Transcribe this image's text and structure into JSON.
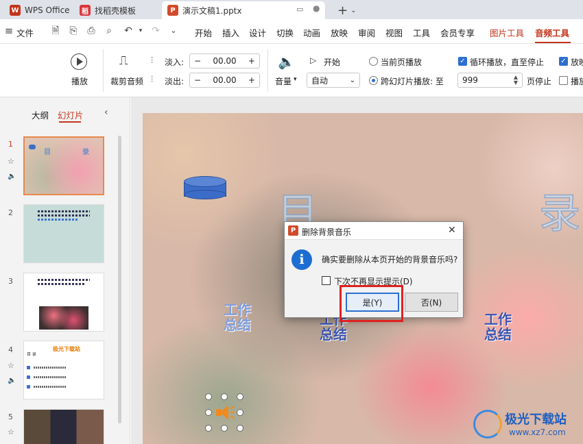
{
  "tabs": {
    "wps": "WPS Office",
    "template": "找稻壳模板",
    "doc": "演示文稿1.pptx",
    "add": "+"
  },
  "menu": {
    "file": "文件",
    "items": [
      "开始",
      "插入",
      "设计",
      "切换",
      "动画",
      "放映",
      "审阅",
      "视图",
      "工具",
      "会员专享"
    ],
    "picture_tools": "图片工具",
    "audio_tools": "音频工具"
  },
  "ribbon": {
    "play": "播放",
    "trim": "裁剪音频",
    "fade_in": "淡入:",
    "fade_in_value": "00.00",
    "fade_out": "淡出:",
    "fade_out_value": "00.00",
    "minus": "−",
    "plus": "+",
    "volume": "音量",
    "start": "开始",
    "start_value": "自动",
    "current_page": "当前页播放",
    "cross_slide": "跨幻灯片播放: 至",
    "page_value": "999",
    "page_stop": "页停止",
    "loop": "循环播放，直至停止",
    "play_hide": "放映",
    "play_rewind": "播放"
  },
  "leftpanel": {
    "outline": "大纲",
    "slides": "幻灯片",
    "slide_numbers": [
      "1",
      "2",
      "3",
      "4",
      "5"
    ],
    "thumb1_title_a": "目",
    "thumb1_title_b": "录",
    "thumb4_title": "极光下载站",
    "thumb4_sub": "目 录"
  },
  "slide": {
    "big_a": "目",
    "big_b": "录",
    "work1": [
      "工作",
      "总结"
    ],
    "work2": [
      "工作",
      "总结"
    ],
    "work3": [
      "工作",
      "总结"
    ]
  },
  "dialog": {
    "title": "删除背景音乐",
    "message": "确实要删除从本页开始的背景音乐吗?",
    "checkbox": "下次不再显示提示(D)",
    "yes": "是(Y)",
    "no": "否(N)",
    "close": "✕"
  },
  "watermark": {
    "name": "极光下载站",
    "url": "www.xz7.com"
  },
  "colors": {
    "accent": "#c4351b",
    "primary_blue": "#2c6fd1",
    "highlight_red": "#e02020"
  }
}
